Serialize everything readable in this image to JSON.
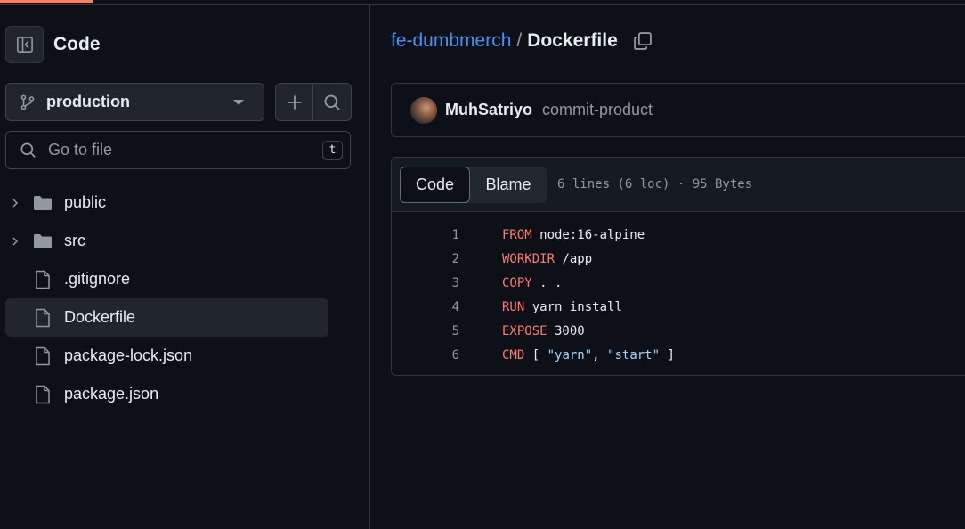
{
  "sidebar": {
    "title": "Code",
    "branch": "production",
    "search_placeholder": "Go to file",
    "search_shortcut": "t",
    "items": [
      {
        "type": "folder",
        "label": "public",
        "active": false
      },
      {
        "type": "folder",
        "label": "src",
        "active": false
      },
      {
        "type": "file",
        "label": ".gitignore",
        "active": false
      },
      {
        "type": "file",
        "label": "Dockerfile",
        "active": true
      },
      {
        "type": "file",
        "label": "package-lock.json",
        "active": false
      },
      {
        "type": "file",
        "label": "package.json",
        "active": false
      }
    ]
  },
  "breadcrumb": {
    "repo": "fe-dumbmerch",
    "separator": "/",
    "file": "Dockerfile"
  },
  "commit": {
    "author": "MuhSatriyo",
    "message": "commit-product"
  },
  "file": {
    "tabs": {
      "code": "Code",
      "blame": "Blame"
    },
    "meta": "6 lines (6 loc) · 95 Bytes",
    "lines": [
      {
        "number": "1",
        "keyword": "FROM",
        "rest": " node:16-alpine"
      },
      {
        "number": "2",
        "keyword": "WORKDIR",
        "rest": " /app"
      },
      {
        "number": "3",
        "keyword": "COPY",
        "rest": " . ."
      },
      {
        "number": "4",
        "keyword": "RUN",
        "rest": " yarn install"
      },
      {
        "number": "5",
        "keyword": "EXPOSE",
        "rest": " 3000"
      },
      {
        "number": "6",
        "keyword": "CMD",
        "rest_parts": [
          " [ ",
          "\"yarn\"",
          ", ",
          "\"start\"",
          " ]"
        ]
      }
    ]
  },
  "colors": {
    "accent_link": "#4493f8",
    "keyword": "#ff7b72",
    "string": "#a5d6ff",
    "progress": "#f78166"
  }
}
